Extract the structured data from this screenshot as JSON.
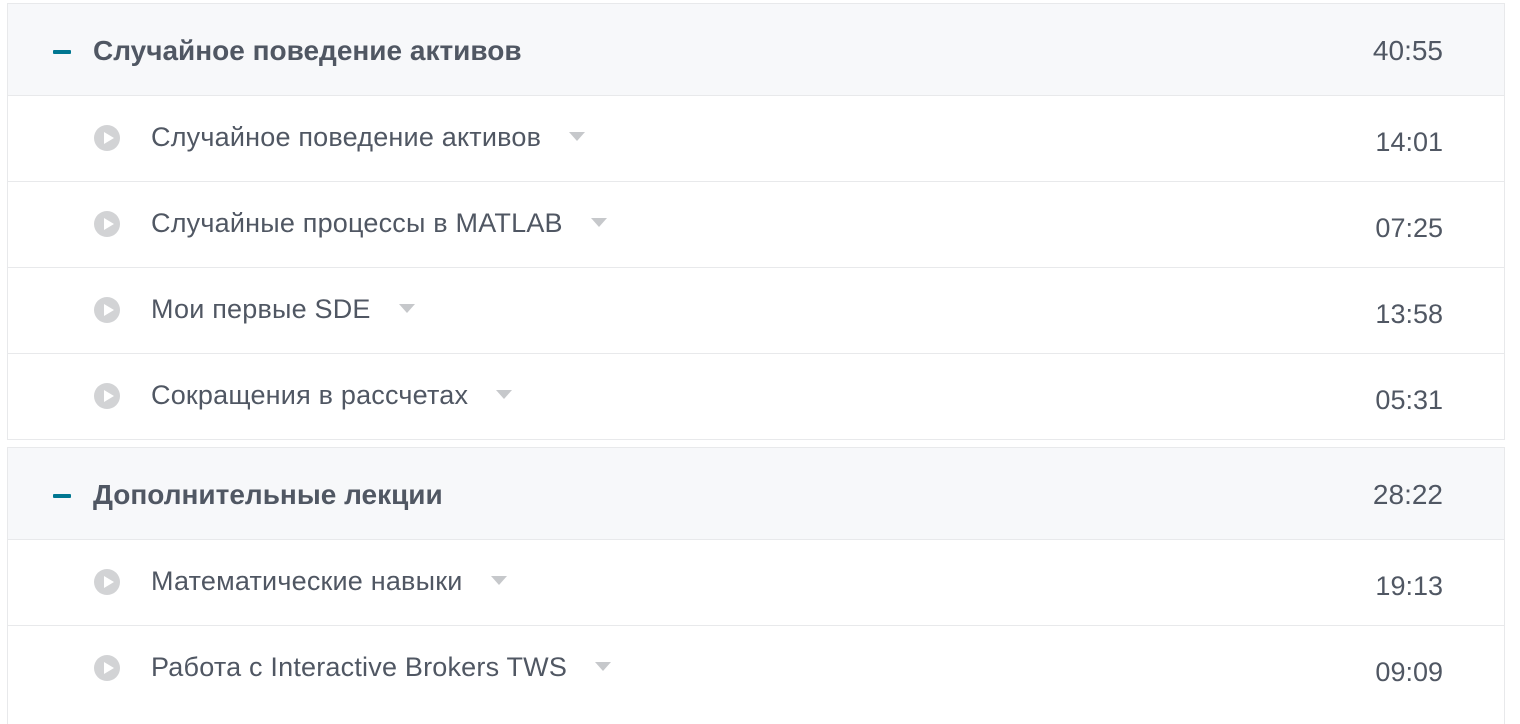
{
  "sections": [
    {
      "title": "Случайное поведение активов",
      "duration": "40:55",
      "lectures": [
        {
          "title": "Случайное поведение активов",
          "duration": "14:01"
        },
        {
          "title": "Случайные процессы в MATLAB",
          "duration": "07:25"
        },
        {
          "title": "Мои первые SDE",
          "duration": "13:58"
        },
        {
          "title": "Сокращения в рассчетах",
          "duration": "05:31"
        }
      ]
    },
    {
      "title": "Дополнительные лекции",
      "duration": "28:22",
      "lectures": [
        {
          "title": "Математические навыки",
          "duration": "19:13"
        },
        {
          "title": "Работа с Interactive Brokers TWS",
          "duration": "09:09"
        }
      ]
    }
  ],
  "colors": {
    "accent": "#007791",
    "text": "#505763",
    "icon_gray": "#d2d3d5",
    "caret_gray": "#c6c8cb",
    "header_bg": "#f7f8fa",
    "border": "#e8e9eb"
  },
  "icons": {
    "collapse": "minus-icon",
    "play": "play-circle-icon",
    "expand_details": "caret-down-icon"
  }
}
